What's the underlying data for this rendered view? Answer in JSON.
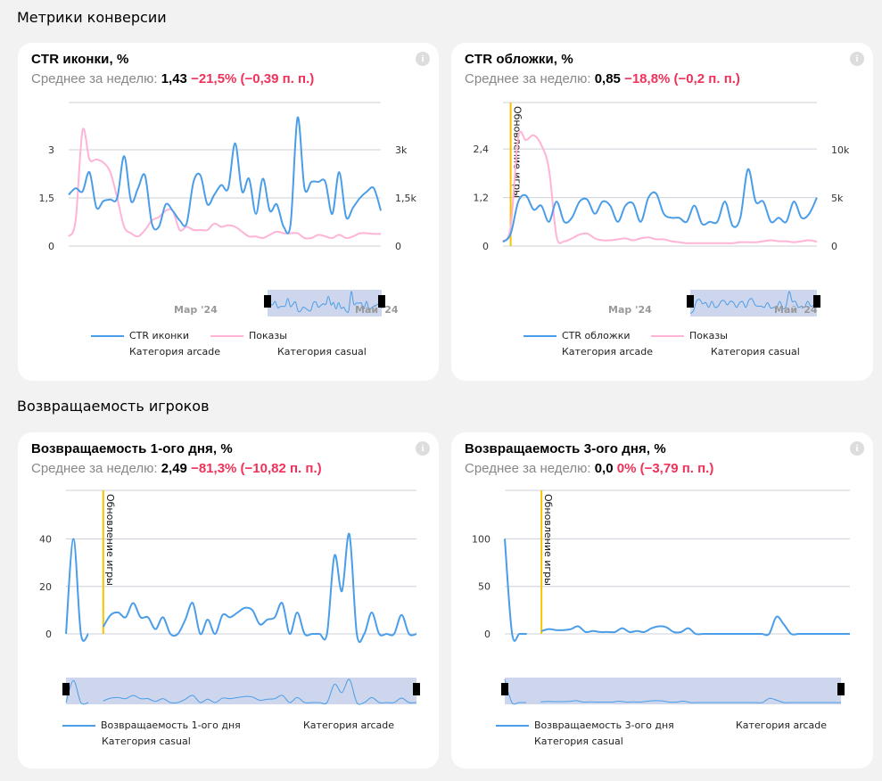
{
  "sections": {
    "conversion": "Метрики конверсии",
    "retention": "Возвращаемость игроков"
  },
  "colors": {
    "blue": "#4a9de8",
    "pink": "#ffb3d6",
    "update": "#f5c400",
    "delta_negative": "#f0325a",
    "navigator": "#cdd6ec"
  },
  "weekly_label": "Среднее за неделю:",
  "cards": [
    {
      "title": "CTR иконки, %",
      "avg": "1,43",
      "delta": "−21,5% (−0,39 п. п.)",
      "info_icon": "info-icon",
      "legend": [
        "CTR иконки",
        "Показы",
        "Категория arcade",
        "Категория casual"
      ],
      "x_labels": [
        "Мар '24",
        "Май '24"
      ]
    },
    {
      "title": "CTR обложки, %",
      "avg": "0,85",
      "delta": "−18,8% (−0,2 п. п.)",
      "info_icon": "info-icon",
      "legend": [
        "CTR обложки",
        "Показы",
        "Категория arcade",
        "Категория casual"
      ],
      "x_labels": [
        "Мар '24",
        "Май '24"
      ]
    },
    {
      "title": "Возвращаемость 1-ого дня, %",
      "avg": "2,49",
      "delta": "−81,3% (−10,82 п. п.)",
      "info_icon": "info-icon",
      "legend": [
        "Возвращаемость 1-ого дня",
        "Категория arcade",
        "Категория casual"
      ]
    },
    {
      "title": "Возвращаемость 3-ого дня, %",
      "avg": "0,0",
      "delta": "0% (−3,79 п. п.)",
      "info_icon": "info-icon",
      "legend": [
        "Возвращаемость 3-ого дня",
        "Категория arcade",
        "Категория casual"
      ]
    }
  ],
  "chart_data": [
    {
      "type": "line",
      "left_ticks": [
        "0",
        "1,5",
        "3"
      ],
      "left_tick_values": [
        0,
        1.5,
        3
      ],
      "right_ticks": [
        "0",
        "1,5k",
        "3k"
      ],
      "right_tick_values": [
        0,
        1500,
        3000
      ],
      "series": [
        {
          "name": "CTR иконки",
          "axis": "left",
          "color": "#4a9de8",
          "values": [
            1.6,
            1.8,
            1.7,
            2.3,
            1.2,
            1.4,
            1.45,
            1.5,
            2.8,
            1.4,
            1.8,
            2.2,
            0.7,
            0.6,
            1.3,
            1.1,
            0.8,
            0.7,
            2.0,
            2.2,
            1.3,
            1.6,
            1.9,
            1.8,
            3.2,
            1.7,
            2.1,
            1.0,
            2.1,
            1.1,
            1.3,
            0.6,
            0.7,
            4.0,
            1.8,
            2.0,
            2.0,
            2.0,
            1.0,
            2.3,
            0.9,
            1.2,
            1.5,
            1.7,
            1.8,
            1.1
          ]
        },
        {
          "name": "Показы",
          "axis": "right",
          "color": "#ffb3d6",
          "values": [
            300,
            800,
            3600,
            2700,
            2700,
            2600,
            2300,
            1500,
            600,
            400,
            300,
            500,
            800,
            900,
            1100,
            1100,
            500,
            600,
            500,
            500,
            500,
            700,
            600,
            650,
            600,
            450,
            300,
            300,
            250,
            350,
            450,
            400,
            400,
            400,
            250,
            250,
            350,
            300,
            250,
            350,
            250,
            300,
            400,
            400,
            380,
            380
          ]
        }
      ]
    },
    {
      "type": "line",
      "left_ticks": [
        "0",
        "1,2",
        "2,4"
      ],
      "left_tick_values": [
        0,
        1.2,
        2.4
      ],
      "right_ticks": [
        "0",
        "5k",
        "10k"
      ],
      "right_tick_values": [
        0,
        5000,
        10000
      ],
      "annotation": {
        "label": "Обновление игры",
        "at_index": 1
      },
      "series": [
        {
          "name": "CTR обложки",
          "axis": "left",
          "color": "#4a9de8",
          "values": [
            0.1,
            0.3,
            1.1,
            1.25,
            0.9,
            1.0,
            0.6,
            1.1,
            0.6,
            0.7,
            1.1,
            1.15,
            0.8,
            1.1,
            1.0,
            0.6,
            1.0,
            1.05,
            0.6,
            1.2,
            1.3,
            0.8,
            0.7,
            0.7,
            0.6,
            1.0,
            0.55,
            0.6,
            0.6,
            1.1,
            0.5,
            0.7,
            1.9,
            1.1,
            1.1,
            0.6,
            0.7,
            0.6,
            1.1,
            0.7,
            0.8,
            1.2
          ]
        },
        {
          "name": "Показы",
          "axis": "right",
          "color": "#ffb3d6",
          "values": [
            500,
            2000,
            11300,
            11000,
            11500,
            10500,
            8000,
            1000,
            500,
            800,
            1200,
            1300,
            800,
            600,
            600,
            700,
            800,
            600,
            800,
            900,
            700,
            700,
            500,
            400,
            300,
            300,
            300,
            300,
            300,
            300,
            300,
            400,
            400,
            400,
            500,
            600,
            500,
            500,
            400,
            500,
            600,
            450
          ]
        }
      ]
    },
    {
      "type": "line",
      "left_ticks": [
        "0",
        "20",
        "40"
      ],
      "left_tick_values": [
        0,
        20,
        40
      ],
      "annotation": {
        "label": "Обновление игры",
        "at_index": 5
      },
      "series": [
        {
          "name": "Возвращаемость 1-ого дня",
          "axis": "left",
          "color": "#4a9de8",
          "values": [
            0,
            40,
            0,
            0,
            null,
            3,
            8,
            9,
            7,
            13,
            7,
            7,
            2,
            7,
            0,
            0,
            6,
            13,
            0,
            6,
            0,
            8,
            7,
            9,
            11,
            10,
            4,
            6,
            7,
            13,
            0,
            9,
            0,
            0,
            0,
            0,
            33,
            18,
            42,
            0,
            0,
            9,
            0,
            0,
            0,
            8,
            0,
            0
          ]
        }
      ]
    },
    {
      "type": "line",
      "left_ticks": [
        "0",
        "50",
        "100"
      ],
      "left_tick_values": [
        0,
        50,
        100
      ],
      "annotation": {
        "label": "Обновление игры",
        "at_index": 5
      },
      "series": [
        {
          "name": "Возвращаемость 3-ого дня",
          "axis": "left",
          "color": "#4a9de8",
          "values": [
            100,
            0,
            0,
            0,
            null,
            3,
            5,
            4,
            4,
            5,
            8,
            2,
            3,
            2,
            2,
            2,
            6,
            2,
            3,
            2,
            6,
            8,
            7,
            2,
            2,
            6,
            0,
            0,
            0,
            0,
            0,
            0,
            0,
            0,
            0,
            0,
            0,
            18,
            10,
            0,
            0,
            0,
            0,
            0,
            0,
            0,
            0,
            0
          ]
        }
      ]
    }
  ]
}
